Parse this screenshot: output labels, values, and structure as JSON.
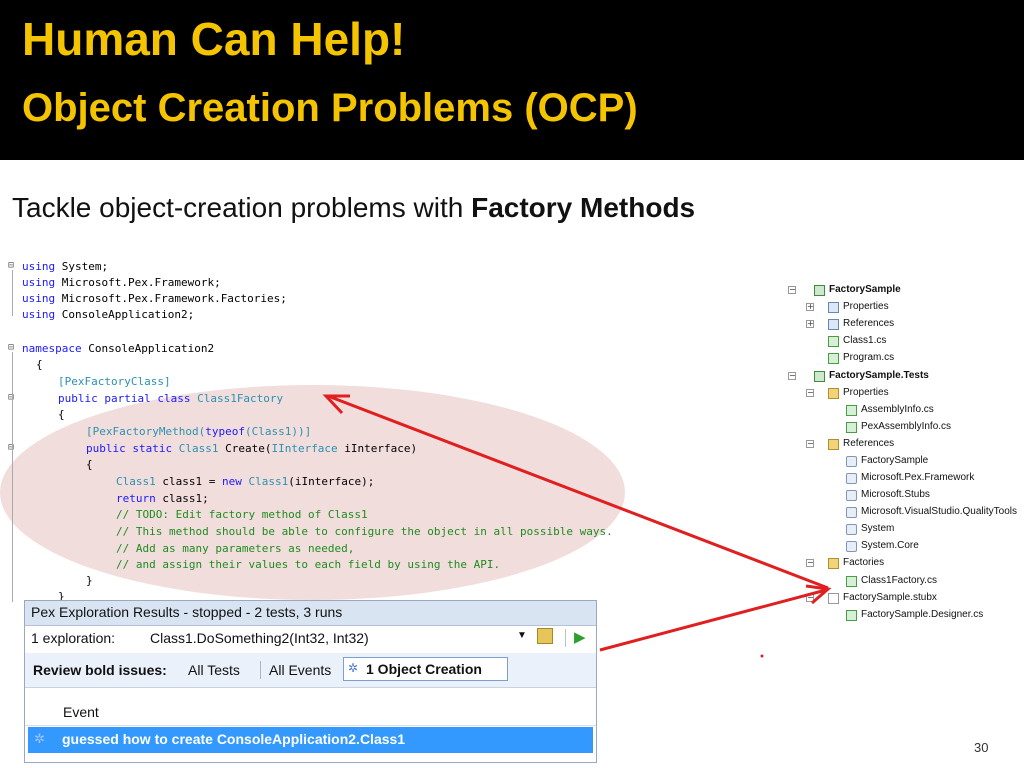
{
  "slide": {
    "title_line1": "Human Can Help!",
    "title_line2": "Object Creation Problems (OCP)",
    "subtitle_prefix": "Tackle object-creation problems with ",
    "subtitle_bold": "Factory Methods",
    "page_number": "30"
  },
  "code": {
    "using1_kw": "using",
    "using1_rest": " System;",
    "using2_kw": "using",
    "using2_rest": " Microsoft.Pex.Framework;",
    "using3_kw": "using",
    "using3_rest": " Microsoft.Pex.Framework.Factories;",
    "using4_kw": "using",
    "using4_rest": " ConsoleApplication2;",
    "ns_kw": "namespace",
    "ns_rest": " ConsoleApplication2",
    "brace_open": "{",
    "attr_class": "[PexFactoryClass]",
    "class_kw": "public partial class",
    "class_name": "Class1Factory",
    "brace_open2": "{",
    "attr_method_open": "[PexFactoryMethod(",
    "attr_method_typeof": "typeof",
    "attr_method_type": "(Class1))]",
    "method_kw": "public static",
    "method_type": "Class1",
    "method_rest": " Create(",
    "method_param_type": "IInterface",
    "method_param": " iInterface)",
    "brace_open3": "{",
    "body1_type": "Class1",
    "body1_mid": " class1 = ",
    "body1_new": "new",
    "body1_ctor": " Class1",
    "body1_end": "(iInterface);",
    "body2_kw": "return",
    "body2_rest": " class1;",
    "comment1": "// TODO: Edit factory method of Class1",
    "comment2": "// This method should be able to configure the object in all possible ways.",
    "comment3": "// Add as many parameters as needed,",
    "comment4": "// and assign their values to each field by using the API.",
    "brace_close3": "}",
    "brace_close2": "}"
  },
  "solution_tree": {
    "items": [
      {
        "label": "FactorySample",
        "icon": "project-icon"
      },
      {
        "label": "Properties",
        "icon": "properties-folder-icon"
      },
      {
        "label": "References",
        "icon": "references-folder-icon"
      },
      {
        "label": "Class1.cs",
        "icon": "csharp-file-icon"
      },
      {
        "label": "Program.cs",
        "icon": "csharp-file-icon"
      },
      {
        "label": "FactorySample.Tests",
        "icon": "project-icon"
      },
      {
        "label": "Properties",
        "icon": "folder-icon"
      },
      {
        "label": "AssemblyInfo.cs",
        "icon": "csharp-file-icon"
      },
      {
        "label": "PexAssemblyInfo.cs",
        "icon": "csharp-file-icon"
      },
      {
        "label": "References",
        "icon": "folder-icon"
      },
      {
        "label": "FactorySample",
        "icon": "reference-icon"
      },
      {
        "label": "Microsoft.Pex.Framework",
        "icon": "reference-icon"
      },
      {
        "label": "Microsoft.Stubs",
        "icon": "reference-icon"
      },
      {
        "label": "Microsoft.VisualStudio.QualityTools",
        "icon": "reference-icon"
      },
      {
        "label": "System",
        "icon": "reference-icon"
      },
      {
        "label": "System.Core",
        "icon": "reference-icon"
      },
      {
        "label": "Factories",
        "icon": "folder-icon"
      },
      {
        "label": "Class1Factory.cs",
        "icon": "csharp-file-icon"
      },
      {
        "label": "FactorySample.stubx",
        "icon": "file-icon"
      },
      {
        "label": "FactorySample.Designer.cs",
        "icon": "csharp-file-icon"
      }
    ]
  },
  "pex_panel": {
    "header": "Pex Exploration Results - stopped - 2 tests, 3 runs",
    "exploration_label": "1 exploration:",
    "exploration_value": "Class1.DoSomething2(Int32, Int32)",
    "review_label": "Review bold issues:",
    "tab_all_tests": "All Tests",
    "tab_all_events": "All Events",
    "tab_object_creation": "1 Object Creation",
    "column_event": "Event",
    "event_row": "guessed how to create ConsoleApplication2.Class1"
  },
  "colors": {
    "title": "#f5c400",
    "arrow": "#e02020",
    "selection": "#3399ff",
    "highlight_ellipse": "#e2b4b4"
  }
}
